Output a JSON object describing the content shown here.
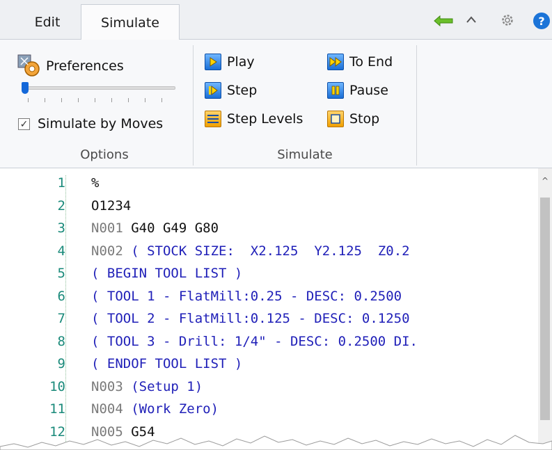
{
  "tabs": [
    {
      "label": "Edit",
      "active": false
    },
    {
      "label": "Simulate",
      "active": true
    }
  ],
  "titlebar_icons": [
    "back-arrow-icon",
    "collapse-ribbon-icon",
    "gear-icon",
    "help-icon"
  ],
  "colors": {
    "accent_blue": "#1468d9",
    "back_arrow_green": "#6bbf2a",
    "comment_blue": "#1f1fb8",
    "line_number_teal": "#1a8a7a"
  },
  "options_group": {
    "preferences_label": "Preferences",
    "simulate_by_moves_label": "Simulate by Moves",
    "simulate_by_moves_checked": true,
    "speed_slider_value": 0.0,
    "group_label": "Options"
  },
  "simulate_group": {
    "play_label": "Play",
    "step_label": "Step",
    "step_levels_label": "Step Levels",
    "to_end_label": "To End",
    "pause_label": "Pause",
    "stop_label": "Stop",
    "group_label": "Simulate"
  },
  "code_lines": [
    {
      "num": "1",
      "n": "",
      "code": "%",
      "comment": ""
    },
    {
      "num": "2",
      "n": "",
      "code": "O1234",
      "comment": ""
    },
    {
      "num": "3",
      "n": "N001",
      "code": "G40 G49 G80",
      "comment": ""
    },
    {
      "num": "4",
      "n": "N002",
      "code": "",
      "comment": "( STOCK SIZE:  X2.125  Y2.125  Z0.2"
    },
    {
      "num": "5",
      "n": "",
      "code": "",
      "comment": "( BEGIN TOOL LIST )"
    },
    {
      "num": "6",
      "n": "",
      "code": "",
      "comment": "( TOOL 1 - FlatMill:0.25 - DESC: 0.2500 "
    },
    {
      "num": "7",
      "n": "",
      "code": "",
      "comment": "( TOOL 2 - FlatMill:0.125 - DESC: 0.1250"
    },
    {
      "num": "8",
      "n": "",
      "code": "",
      "comment": "( TOOL 3 - Drill: 1/4\" - DESC: 0.2500 DI."
    },
    {
      "num": "9",
      "n": "",
      "code": "",
      "comment": "( ENDOF TOOL LIST )"
    },
    {
      "num": "10",
      "n": "N003",
      "code": "",
      "comment": "(Setup 1)"
    },
    {
      "num": "11",
      "n": "N004",
      "code": "",
      "comment": "(Work Zero)"
    },
    {
      "num": "12",
      "n": "N005",
      "code": "G54",
      "comment": ""
    }
  ]
}
